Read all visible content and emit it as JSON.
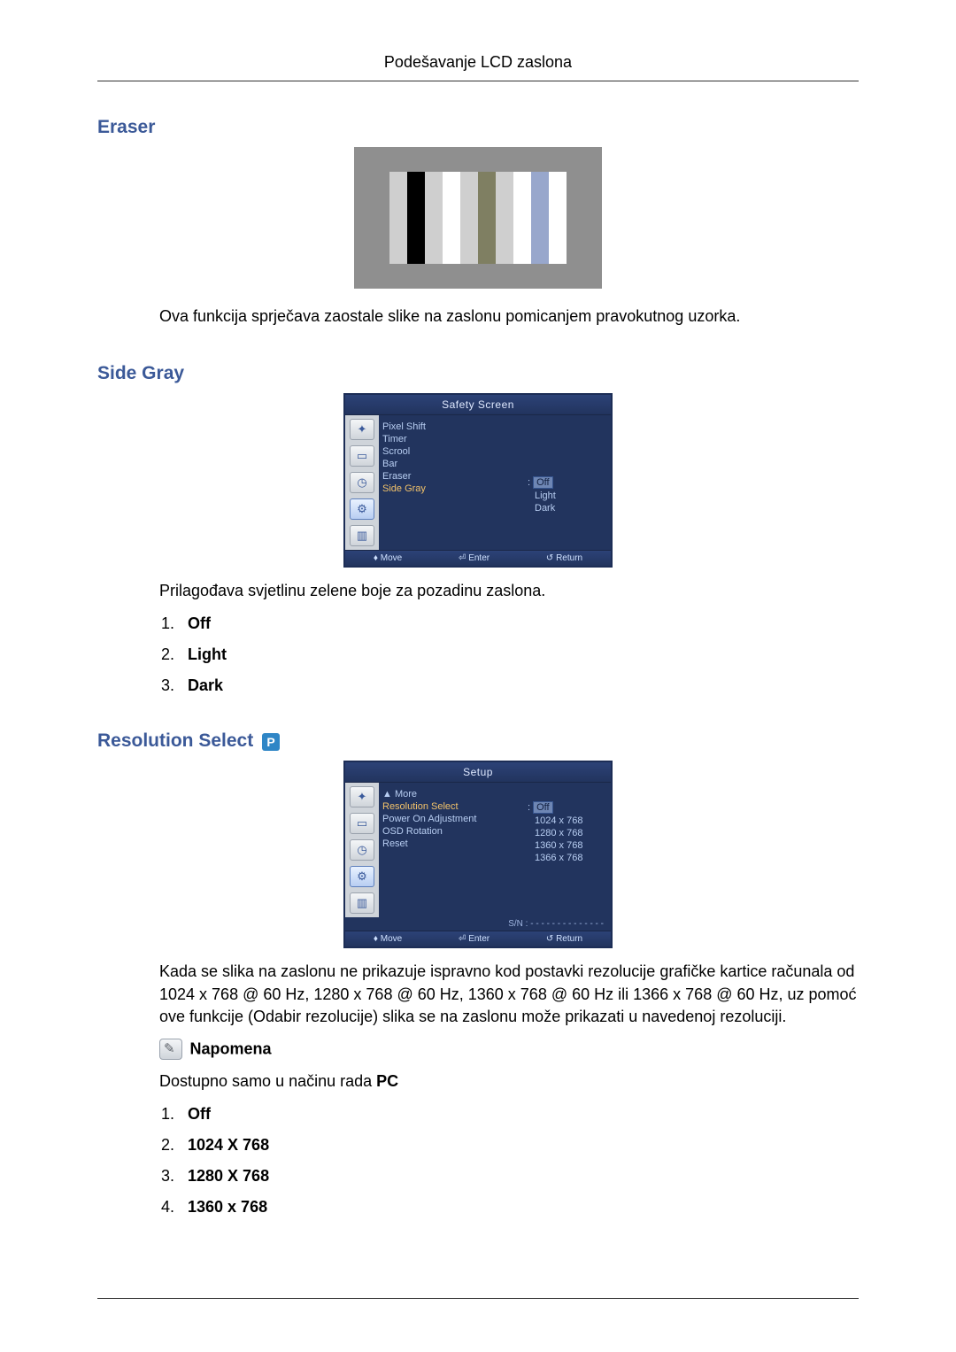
{
  "header": {
    "title": "Podešavanje LCD zaslona"
  },
  "sections": {
    "eraser": {
      "heading": "Eraser",
      "description": "Ova funkcija sprječava zaostale slike na zaslonu pomicanjem pravokutnog uzorka."
    },
    "sideGray": {
      "heading": "Side Gray",
      "description": "Prilagođava svjetlinu zelene boje za pozadinu zaslona.",
      "options": [
        "Off",
        "Light",
        "Dark"
      ],
      "osd": {
        "title": "Safety Screen",
        "labels": [
          "Pixel Shift",
          "Timer",
          "Scrool",
          "Bar",
          "Eraser",
          "Side Gray"
        ],
        "selectedValue": "Off",
        "values": [
          "Light",
          "Dark"
        ],
        "footer": {
          "move": "Move",
          "enter": "Enter",
          "return": "Return"
        }
      }
    },
    "resolution": {
      "heading": "Resolution Select",
      "description": "Kada se slika na zaslonu ne prikazuje ispravno kod postavki rezolucije grafičke kartice računala od 1024 x 768 @ 60 Hz, 1280 x 768 @ 60 Hz, 1360 x 768 @ 60 Hz ili 1366 x 768 @ 60 Hz, uz pomoć ove funkcije (Odabir rezolucije) slika se na zaslonu može prikazati u navedenoj rezoluciji.",
      "noteLabel": "Napomena",
      "noteTextPrefix": "Dostupno samo u načinu rada ",
      "noteTextBold": "PC",
      "options": [
        "Off",
        "1024 X 768",
        "1280 X 768",
        "1360 x 768"
      ],
      "osd": {
        "title": "Setup",
        "moreLabel": "More",
        "labels": [
          "Resolution Select",
          "Power On Adjustment",
          "OSD Rotation",
          "Reset"
        ],
        "selectedValue": "Off",
        "values": [
          "1024 x 768",
          "1280 x 768",
          "1360 x 768",
          "1366 x 768"
        ],
        "snLabel": "S/N :",
        "snValue": "- - - - - - - - - - - - - -",
        "footer": {
          "move": "Move",
          "enter": "Enter",
          "return": "Return"
        }
      }
    }
  }
}
